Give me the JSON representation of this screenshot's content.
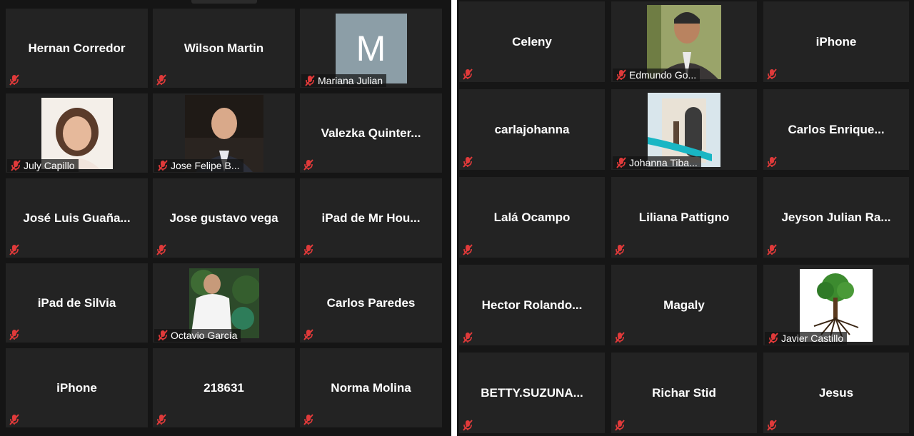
{
  "left_grid": {
    "tiles": [
      {
        "name": "Hernan Corredor",
        "video": false
      },
      {
        "name": "Wilson Martin",
        "video": false
      },
      {
        "name": "Mariana Julian",
        "video": "avatar",
        "avatar_letter": "M"
      },
      {
        "name": "July Capillo",
        "video": "photo"
      },
      {
        "name": "Jose Felipe B...",
        "video": "photo"
      },
      {
        "name": "Valezka  Quinter...",
        "video": false
      },
      {
        "name": "José Luis Guaña...",
        "video": false
      },
      {
        "name": "Jose gustavo vega",
        "video": false
      },
      {
        "name": "iPad de Mr Hou...",
        "video": false
      },
      {
        "name": "iPad de Silvia",
        "video": false
      },
      {
        "name": "Octavio García",
        "video": "photo"
      },
      {
        "name": "Carlos Paredes",
        "video": false
      },
      {
        "name": "iPhone",
        "video": false
      },
      {
        "name": "218631",
        "video": false
      },
      {
        "name": "Norma Molina",
        "video": false
      }
    ]
  },
  "right_grid": {
    "tiles": [
      {
        "name": "Celeny",
        "video": false
      },
      {
        "name": "Edmundo Go...",
        "video": "photo"
      },
      {
        "name": "iPhone",
        "video": false
      },
      {
        "name": "carlajohanna",
        "video": false
      },
      {
        "name": "Johanna Tiba...",
        "video": "photo"
      },
      {
        "name": "Carlos  Enrique...",
        "video": false
      },
      {
        "name": "Lalá Ocampo",
        "video": false
      },
      {
        "name": "Liliana Pattigno",
        "video": false
      },
      {
        "name": "Jeyson  Julian  Ra...",
        "video": false
      },
      {
        "name": "Hector  Rolando...",
        "video": false
      },
      {
        "name": "Magaly",
        "video": false
      },
      {
        "name": "Javier Castillo",
        "video": "photo"
      },
      {
        "name": "BETTY.SUZUNA...",
        "video": false
      },
      {
        "name": "Richar Stid",
        "video": false
      },
      {
        "name": "Jesus",
        "video": false
      }
    ]
  },
  "colors": {
    "tile_bg": "#232323",
    "muted_icon": "#e03a3a",
    "avatar_bg": "#8c9ea7"
  },
  "icons": {
    "muted": "mic-muted-icon"
  }
}
